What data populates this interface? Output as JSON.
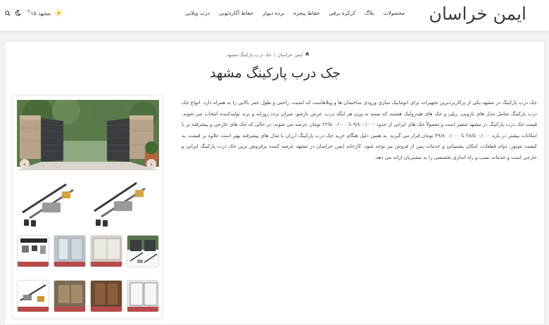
{
  "header": {
    "logo": "ایمن خراسان",
    "nav": [
      "درب ویلایی",
      "حفاظ آکاردئونی",
      "نرده دیوار",
      "حفاظ پنجره",
      "کرکره برقی",
      "بلاگ",
      "محصولات"
    ],
    "weather": {
      "city": "مشهد",
      "temp": "۱۵",
      "unit": "℃"
    }
  },
  "breadcrumb": {
    "home": "ایمن خراسان",
    "separator": "/",
    "current": "جک درب پارکینگ مشهد"
  },
  "title": "جک درب پارکینگ مشهد",
  "description": "جک درب پارکینگ در مشهد یکی از پرکاربردترین تجهیزات برای اتوماتیک سازی ورودی ساختمان ها و ویلاهاست که امنیت، راحتی و طول عمر بالایی را به همراه دارد. انواع جک درب پارکینگ شامل مدل های بازویی، ریلی و جک های هیدرولیک هستند که بسته به وزن هر لنگه درب، عرض بازشو، میزان تردد روزانه و برند تولیدکننده انتخاب می شوند. قیمت جک درب پارکینگ در مشهد متغیر است و معمولاً جک های ایرانی از حدود ۹/۸۰۰/۰۰۰ تا ۲۲/۵۰۰/۰۰۰ تومان عرضه می شوند، در حالی که جک های خارجی و پیشرفته تر با امکانات بیشتر در بازه ۲۸/۵۰۰/۰۰۰ تا ۴۹/۸۰۰/۰۰۰ تومان قرار می گیرند. به همین دلیل هنگام خرید جک درب پارکینگ ارزان یا مدل های پیشرفته بهتر است علاوه بر قیمت، به کیفیت موتور، دوام قطعات، امکان پشتیبانی و خدمات پس از فروش نیز توجه شود. کارخانه ایمن خراسان در مشهد عرضه کننده پرفروش ترین جک درب پارکینگ ایرانی و خارجی است و خدمات نصب و راه اندازی تخصصی را به مشتریان ارائه می دهد.",
  "gallery": {
    "thumbnails": [
      "thumb-gate-jack",
      "thumb-sliding-door",
      "thumb-glass-door",
      "thumb-actuator-kit",
      "thumb-glass-partition",
      "thumb-wood-door",
      "thumb-gate-panel",
      "thumb-motor-parts"
    ],
    "accent": "#e9d9d4"
  }
}
